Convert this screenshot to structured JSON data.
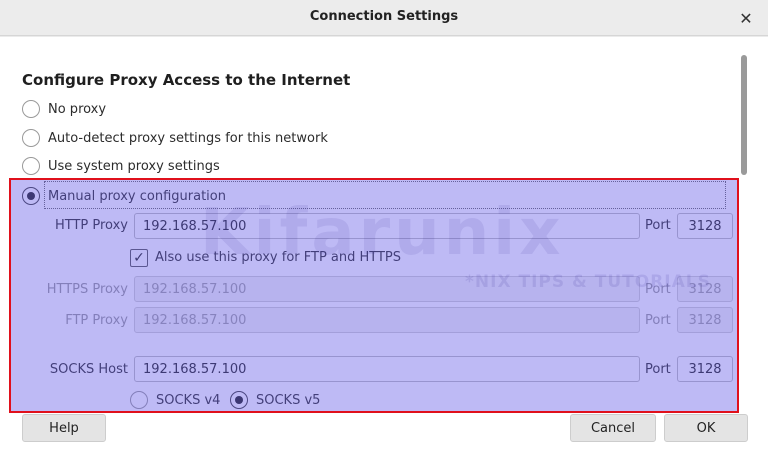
{
  "window": {
    "title": "Connection Settings"
  },
  "heading": "Configure Proxy Access to the Internet",
  "options": [
    {
      "label": "No proxy",
      "checked": false
    },
    {
      "label": "Auto-detect proxy settings for this network",
      "checked": false
    },
    {
      "label": "Use system proxy settings",
      "checked": false
    },
    {
      "label": "Manual proxy configuration",
      "checked": true
    }
  ],
  "http": {
    "label": "HTTP Proxy",
    "value": "192.168.57.100",
    "port_label": "Port",
    "port": "3128"
  },
  "also_use": {
    "label": "Also use this proxy for FTP and HTTPS",
    "checked": true,
    "glyph": "✓"
  },
  "https": {
    "label": "HTTPS Proxy",
    "value": "192.168.57.100",
    "port_label": "Port",
    "port": "3128"
  },
  "ftp": {
    "label": "FTP Proxy",
    "value": "192.168.57.100",
    "port_label": "Port",
    "port": "3128"
  },
  "socks": {
    "label": "SOCKS Host",
    "value": "192.168.57.100",
    "port_label": "Port",
    "port": "3128"
  },
  "socks_versions": [
    {
      "label": "SOCKS v4",
      "checked": false
    },
    {
      "label": "SOCKS v5",
      "checked": true
    }
  ],
  "watermark": {
    "brand": "Kifarunix",
    "tagline": "*NIX TIPS & TUTORIALS"
  },
  "buttons": {
    "help": "Help",
    "cancel": "Cancel",
    "ok": "OK"
  },
  "icons": {
    "close": "close-icon",
    "check": "check-icon"
  },
  "colors": {
    "highlight_fill": "#645ae6",
    "highlight_border": "#e0101c"
  }
}
